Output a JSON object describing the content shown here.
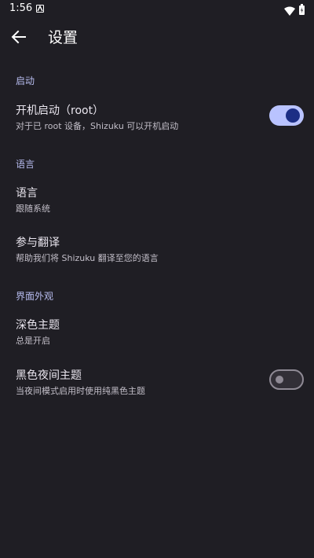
{
  "status_bar": {
    "time": "1:56"
  },
  "app_bar": {
    "title": "设置"
  },
  "sections": {
    "startup": {
      "header": "启动",
      "boot_start": {
        "title": "开机启动（root）",
        "summary": "对于已 root 设备，Shizuku 可以开机启动",
        "enabled": true
      }
    },
    "language": {
      "header": "语言",
      "language_item": {
        "title": "语言",
        "summary": "跟随系统"
      },
      "translate_item": {
        "title": "参与翻译",
        "summary": "帮助我们将 Shizuku 翻译至您的语言"
      }
    },
    "appearance": {
      "header": "界面外观",
      "dark_theme": {
        "title": "深色主题",
        "summary": "总是开启"
      },
      "black_night": {
        "title": "黑色夜间主题",
        "summary": "当夜间模式启用时使用纯黑色主题",
        "enabled": false
      }
    }
  },
  "colors": {
    "background": "#1f1e24",
    "accent": "#b9c3ff",
    "switch_thumb_on": "#1c2e85"
  }
}
